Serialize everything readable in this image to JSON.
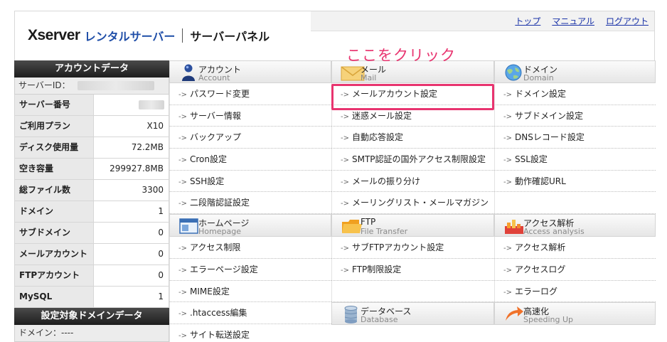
{
  "header": {
    "logo_main": "Xserver",
    "logo_sub": "レンタルサーバー",
    "logo_panel": "サーバーパネル",
    "links": [
      "トップ",
      "マニュアル",
      "ログアウト"
    ]
  },
  "annotation": {
    "callout": "ここをクリック",
    "color": "#e8346f"
  },
  "sidebar": {
    "account_title": "アカウントデータ",
    "server_id_label": "サーバーID：",
    "rows": [
      {
        "label": "サーバー番号",
        "value": ""
      },
      {
        "label": "ご利用プラン",
        "value": "X10"
      },
      {
        "label": "ディスク使用量",
        "value": "72.2MB"
      },
      {
        "label": "空き容量",
        "value": "299927.8MB"
      },
      {
        "label": "総ファイル数",
        "value": "3300"
      },
      {
        "label": "ドメイン",
        "value": "1"
      },
      {
        "label": "サブドメイン",
        "value": "0"
      },
      {
        "label": "メールアカウント",
        "value": "0"
      },
      {
        "label": "FTPアカウント",
        "value": "0"
      },
      {
        "label": "MySQL",
        "value": "1"
      }
    ],
    "domain_title": "設定対象ドメインデータ",
    "domain_label": "ドメイン：----"
  },
  "sections": {
    "account": {
      "title": "アカウント",
      "subtitle": "Account",
      "items": [
        "パスワード変更",
        "サーバー情報",
        "バックアップ",
        "Cron設定",
        "SSH設定",
        "二段階認証設定"
      ]
    },
    "mail": {
      "title": "メール",
      "subtitle": "Mail",
      "items": [
        "メールアカウント設定",
        "迷惑メール設定",
        "自動応答設定",
        "SMTP認証の国外アクセス制限設定",
        "メールの振り分け",
        "メーリングリスト・メールマガジン"
      ]
    },
    "domain": {
      "title": "ドメイン",
      "subtitle": "Domain",
      "items": [
        "ドメイン設定",
        "サブドメイン設定",
        "DNSレコード設定",
        "SSL設定",
        "動作確認URL"
      ]
    },
    "homepage": {
      "title": "ホームページ",
      "subtitle": "Homepage",
      "items": [
        "アクセス制限",
        "エラーページ設定",
        "MIME設定",
        ".htaccess編集",
        "サイト転送設定"
      ]
    },
    "ftp": {
      "title": "FTP",
      "subtitle": "File Transfer",
      "items": [
        "サブFTPアカウント設定",
        "FTP制限設定"
      ]
    },
    "access": {
      "title": "アクセス解析",
      "subtitle": "Access analysis",
      "items": [
        "アクセス解析",
        "アクセスログ",
        "エラーログ"
      ]
    },
    "database": {
      "title": "データベース",
      "subtitle": "Database"
    },
    "speed": {
      "title": "高速化",
      "subtitle": "Speeding Up"
    }
  }
}
